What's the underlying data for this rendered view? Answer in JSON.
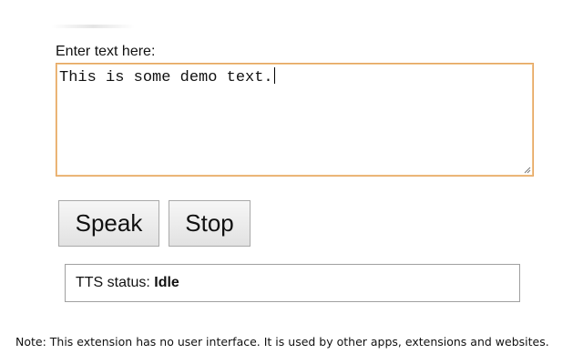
{
  "form": {
    "label": "Enter text here:",
    "textarea_value": "This is some demo text."
  },
  "buttons": {
    "speak_label": "Speak",
    "stop_label": "Stop"
  },
  "status": {
    "prefix": "TTS status: ",
    "value": "Idle"
  },
  "note": "Note: This extension has no user interface. It is used by other apps, extensions and websites.",
  "colors": {
    "textarea_focus_border": "#e5a55f",
    "button_border": "#a9a9a9",
    "status_border": "#a0a0a0"
  }
}
